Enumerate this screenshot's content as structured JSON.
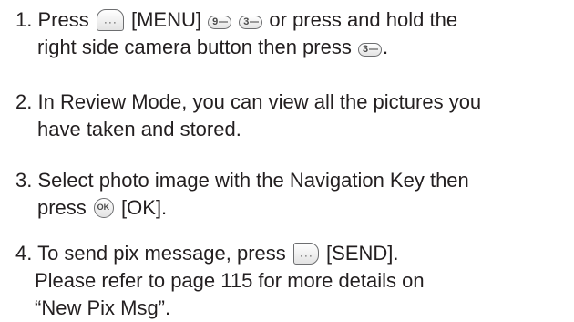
{
  "steps": [
    {
      "number": "1.",
      "text_a": "Press",
      "text_b": "[MENU]",
      "text_c": "or press and hold the",
      "line2_a": "right side camera button then press",
      "line2_b": ".",
      "keys": {
        "menu_icon": "menu-soft-key",
        "key_9": "9",
        "key_9_letters": "wxyz",
        "key_3": "3",
        "key_3_letters": "def"
      }
    },
    {
      "number": "2.",
      "line1": "In Review Mode, you can view all the pictures you",
      "line2": "have taken and stored."
    },
    {
      "number": "3.",
      "line1": "Select photo image with the Navigation Key then",
      "line2_a": "press",
      "ok_key": "OK",
      "line2_b": "[OK]."
    },
    {
      "number": "4.",
      "line1_a": "To send pix message, press",
      "line1_b": "[SEND].",
      "line2": "Please refer to page 115 for more details on",
      "line3": "“New Pix Msg”."
    }
  ],
  "colors": {
    "text": "#231f20",
    "key_border": "#6d6e70"
  }
}
